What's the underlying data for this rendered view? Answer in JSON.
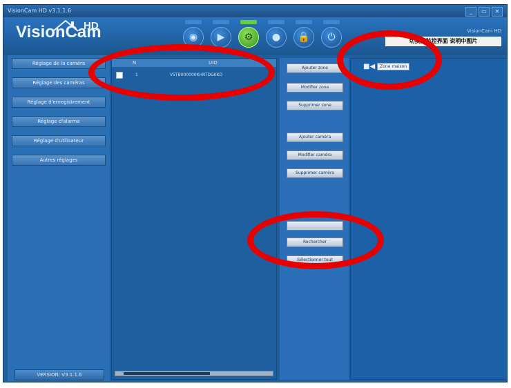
{
  "window": {
    "title": "VisionCam HD v3.1.1.6",
    "buttons": [
      "_",
      "▭",
      "✕"
    ]
  },
  "header": {
    "logo_text": "VisionCam",
    "logo_badge": "HD",
    "info_text": "VisionCam HD",
    "status_bar": "切换至监控界面  说明中图片"
  },
  "toolbar": [
    {
      "name": "camera-view-icon",
      "glyph": "◉"
    },
    {
      "name": "play-icon",
      "glyph": "▶"
    },
    {
      "name": "settings-gear-icon",
      "glyph": "⚙",
      "active": true
    },
    {
      "name": "record-icon",
      "glyph": "●"
    },
    {
      "name": "lock-icon",
      "glyph": "🔒"
    },
    {
      "name": "power-icon",
      "glyph": "⏻"
    }
  ],
  "sidebar": {
    "items": [
      {
        "label": "Réglage de la caméra"
      },
      {
        "label": "Réglage des caméras"
      },
      {
        "label": "Réglage d'enregistrement"
      },
      {
        "label": "Réglage d'alarme"
      },
      {
        "label": "Réglage d'utilisateur"
      },
      {
        "label": "Autres réglages"
      }
    ],
    "version": "VERSION: V3.1.1.6"
  },
  "list": {
    "columns": [
      "N",
      "UID"
    ],
    "rows": [
      {
        "index": "1",
        "value": "VSTB000000KHRTDGKKD"
      }
    ]
  },
  "actions": {
    "buttons": [
      "Ajouter zone",
      "Modifier zone",
      "Supprimer zone",
      "Ajouter caméra",
      "Modifier caméra",
      "Supprimer caméra",
      "",
      "Rechercher",
      "Sélectionner tout"
    ]
  },
  "cameras": {
    "items": [
      {
        "label": "Zone maison"
      }
    ]
  },
  "colors": {
    "window_bg": "#1f5f9d",
    "highlight_ring": "#e60000",
    "active_tool": "#6acd3c"
  }
}
